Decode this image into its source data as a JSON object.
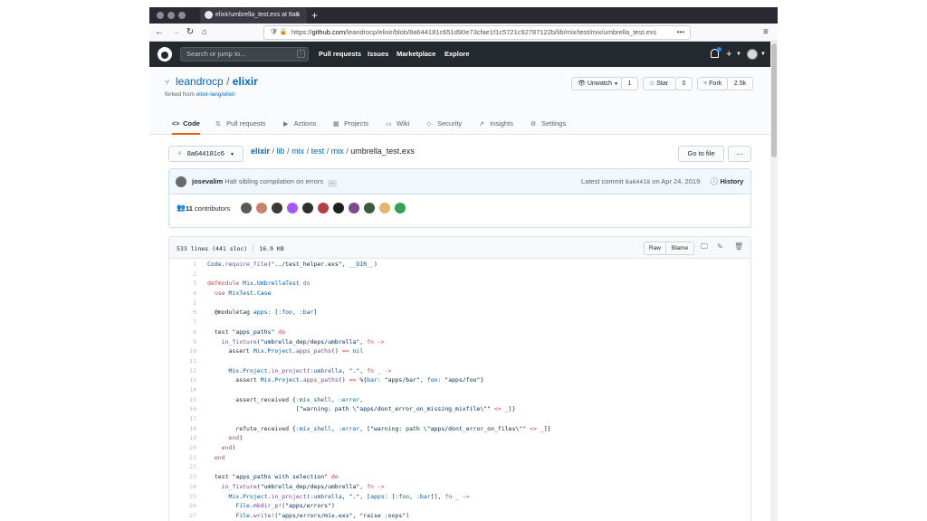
{
  "browser": {
    "tab_title": "elixir/umbrella_test.exs at 8a6",
    "tab_close": "×",
    "new_tab": "+",
    "url_prefix": "https://",
    "url_domain": "github.com",
    "url_path": "/leandrocp/elixir/blob/8a644181c651d90e73cfae1f1c5721c92787122b/lib/mix/test/mix/umbrella_test.exs",
    "url_more": "•••",
    "back_icon": "←",
    "forward_icon": "→",
    "reload_icon": "↻",
    "home_icon": "⌂",
    "menu_icon": "≡"
  },
  "github_header": {
    "search_placeholder": "Search or jump to...",
    "search_shortcut": "/",
    "nav": [
      "Pull requests",
      "Issues",
      "Marketplace",
      "Explore"
    ],
    "plus": "+"
  },
  "repo": {
    "owner": "leandrocp",
    "separator": "/",
    "name": "elixir",
    "forked_prefix": "forked from ",
    "forked_from": "elixir-lang/elixir",
    "unwatch_label": "Unwatch",
    "watch_count": "1",
    "star_label": "Star",
    "star_count": "0",
    "fork_label": "Fork",
    "fork_count": "2.5k",
    "tabs": [
      "Code",
      "Pull requests",
      "Actions",
      "Projects",
      "Wiki",
      "Security",
      "Insights",
      "Settings"
    ]
  },
  "file_nav": {
    "branch": "8a644181c6",
    "breadcrumb": [
      "elixir",
      "lib",
      "mix",
      "test",
      "mix",
      "umbrella_test.exs"
    ],
    "go_to_file": "Go to file",
    "more": "..."
  },
  "commit": {
    "author": "josevalim",
    "message": "Halt sibling compilation on errors",
    "ellipsis": "…",
    "latest_prefix": "Latest commit",
    "sha": "8a64418",
    "date": "on Apr 24, 2019",
    "history_label": "History",
    "contributors_count": "11",
    "contributors_label": "contributors",
    "avatar_colors": [
      "#5a5a5a",
      "#c9826b",
      "#3a3a3a",
      "#a855f7",
      "#2f2f2f",
      "#b43f3f",
      "#1f1f1f",
      "#7c4a8c",
      "#3d5a3d",
      "#e8b36a",
      "#2ea44f"
    ]
  },
  "file": {
    "lines_info": "533 lines (441 sloc)",
    "size": "16.9 KB",
    "raw_label": "Raw",
    "blame_label": "Blame"
  }
}
